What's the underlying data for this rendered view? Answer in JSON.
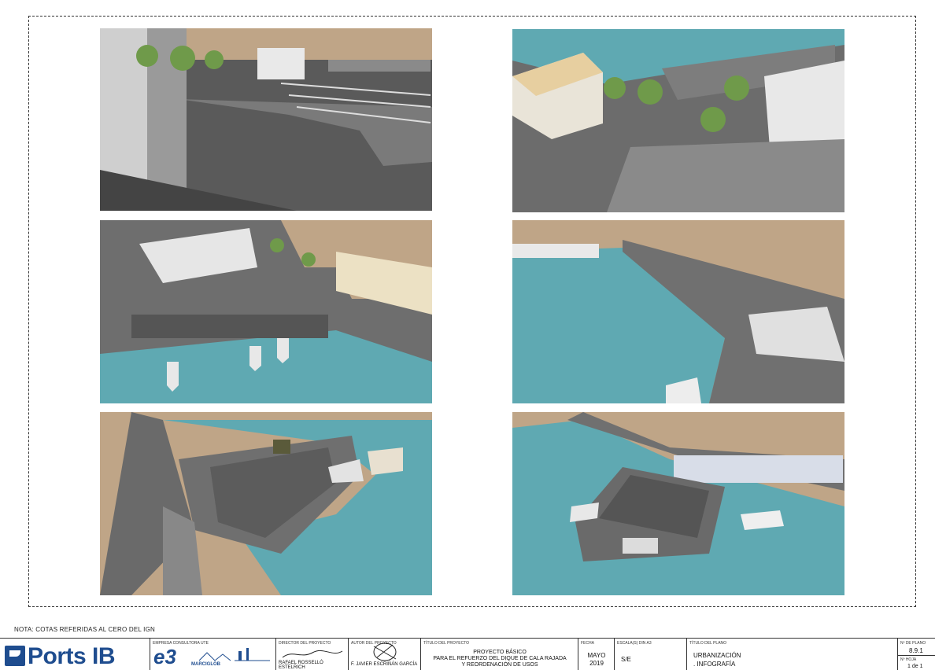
{
  "note": "NOTA: COTAS REFERIDAS AL CERO DEL IGN",
  "colors": {
    "sand": "#bfa587",
    "water": "#5fa9b2",
    "concrete": "#6b6b6b",
    "brand_blue": "#1f4d8f"
  },
  "renders": [
    {
      "id": "render-1",
      "view": "promenade-pergolas"
    },
    {
      "id": "render-2",
      "view": "buildings-plaza"
    },
    {
      "id": "render-3",
      "view": "aerial-harbour-boats"
    },
    {
      "id": "render-4",
      "view": "breakwater-basin"
    },
    {
      "id": "render-5",
      "view": "pier-from-land"
    },
    {
      "id": "render-6",
      "view": "pier-from-sea"
    }
  ],
  "titleblock": {
    "logo_text": "Ports IB",
    "empresa_label": "EMPRESA CONSULTORA UTE",
    "e3_text": "e3",
    "e3_sub": "EQUIPO",
    "marciglob": "MARCIGLOB",
    "director_label": "DIRECTOR DEL PROYECTO",
    "director_name": "RAFAEL ROSSELLÓ ESTELRICH",
    "autor_label": "AUTOR DEL PROYECTO",
    "autor_name": "F. JAVIER ESCRIÑÁN GARCÍA",
    "titulo_proyecto_label": "TÍTULO DEL PROYECTO",
    "titulo_proyecto_line1": "PROYECTO BÁSICO",
    "titulo_proyecto_line2": "PARA EL REFUERZO DEL DIQUE DE CALA RAJADA",
    "titulo_proyecto_line3": "Y REORDENACIÓN DE USOS",
    "fecha_label": "FECHA",
    "fecha_month": "MAYO",
    "fecha_year": "2019",
    "escala_label": "ESCALA(S) DIN A3",
    "escala_value": "S/E",
    "titulo_plano_label": "TÍTULO DEL PLANO",
    "titulo_plano_line1": "URBANIZACIÓN",
    "titulo_plano_line2": ". INFOGRAFÍA",
    "plano_no_label": "Nº DE PLANO",
    "plano_no": "8.9.1",
    "hoja_label": "Nº HOJA",
    "hoja_value": "1 de 1"
  }
}
